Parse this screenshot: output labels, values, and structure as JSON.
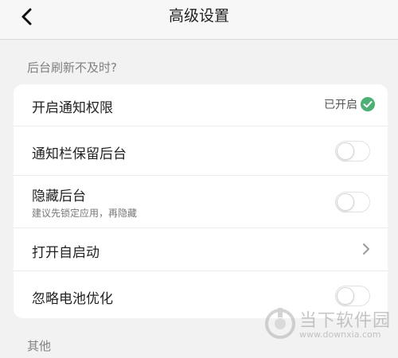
{
  "header": {
    "title": "高级设置",
    "back_icon": "chevron-left-icon"
  },
  "sections": {
    "background_refresh": "后台刷新不及时?",
    "others": "其他"
  },
  "settings": {
    "notification_permission": {
      "label": "开启通知权限",
      "status": "已开启",
      "status_icon": "check-circle-icon",
      "status_color": "#4caf73"
    },
    "keep_in_notification_bar": {
      "label": "通知栏保留后台",
      "enabled": false
    },
    "hide_background": {
      "label": "隐藏后台",
      "description": "建议先锁定应用，再隐藏",
      "enabled": false
    },
    "auto_start": {
      "label": "打开自启动",
      "icon": "chevron-right-icon"
    },
    "ignore_battery_optimization": {
      "label": "忽略电池优化",
      "enabled": false
    }
  },
  "watermark": {
    "name": "当下软件园",
    "url": "www.downxia.com"
  }
}
